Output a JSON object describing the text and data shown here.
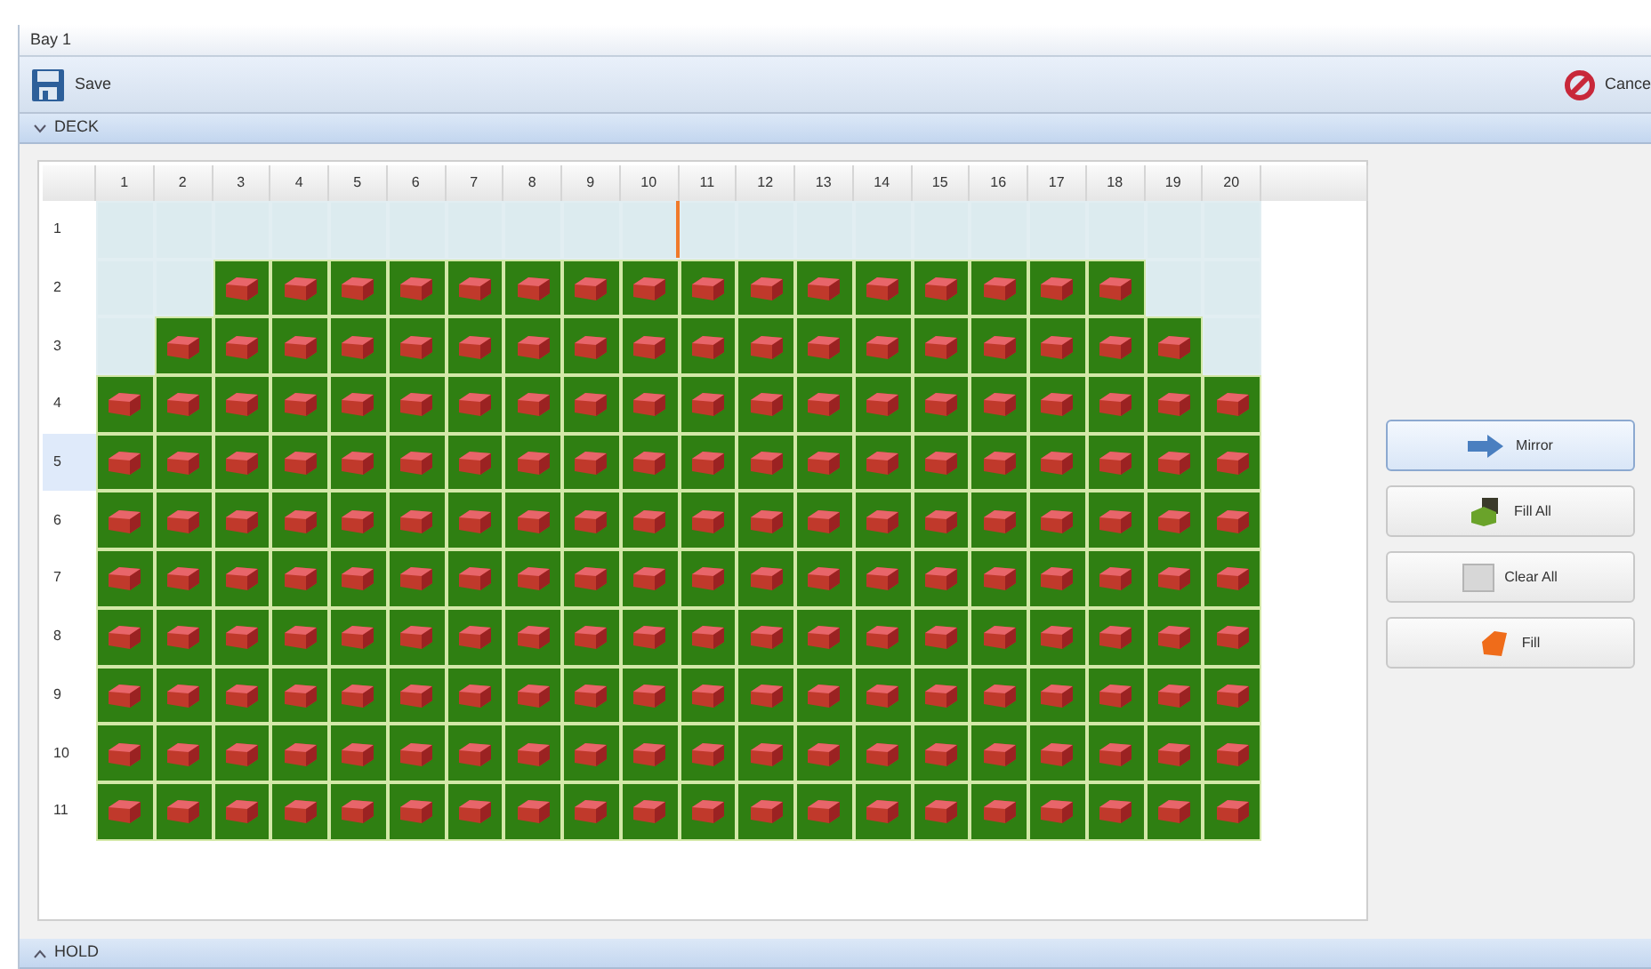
{
  "window": {
    "title": "Bay 1"
  },
  "toolbar": {
    "save": "Save",
    "cancel": "Cance"
  },
  "deck": {
    "title": "DECK",
    "expanded": true,
    "columns": [
      "1",
      "2",
      "3",
      "4",
      "5",
      "6",
      "7",
      "8",
      "9",
      "10",
      "11",
      "12",
      "13",
      "14",
      "15",
      "16",
      "17",
      "18",
      "19",
      "20"
    ],
    "rows": [
      {
        "label": "1",
        "selected": false,
        "filled": [
          false,
          false,
          false,
          false,
          false,
          false,
          false,
          false,
          false,
          false,
          false,
          false,
          false,
          false,
          false,
          false,
          false,
          false,
          false,
          false
        ]
      },
      {
        "label": "2",
        "selected": false,
        "filled": [
          false,
          false,
          true,
          true,
          true,
          true,
          true,
          true,
          true,
          true,
          true,
          true,
          true,
          true,
          true,
          true,
          true,
          true,
          false,
          false
        ]
      },
      {
        "label": "3",
        "selected": false,
        "filled": [
          false,
          true,
          true,
          true,
          true,
          true,
          true,
          true,
          true,
          true,
          true,
          true,
          true,
          true,
          true,
          true,
          true,
          true,
          true,
          false
        ]
      },
      {
        "label": "4",
        "selected": false,
        "filled": [
          true,
          true,
          true,
          true,
          true,
          true,
          true,
          true,
          true,
          true,
          true,
          true,
          true,
          true,
          true,
          true,
          true,
          true,
          true,
          true
        ]
      },
      {
        "label": "5",
        "selected": true,
        "filled": [
          true,
          true,
          true,
          true,
          true,
          true,
          true,
          true,
          true,
          true,
          true,
          true,
          true,
          true,
          true,
          true,
          true,
          true,
          true,
          true
        ]
      },
      {
        "label": "6",
        "selected": false,
        "filled": [
          true,
          true,
          true,
          true,
          true,
          true,
          true,
          true,
          true,
          true,
          true,
          true,
          true,
          true,
          true,
          true,
          true,
          true,
          true,
          true
        ]
      },
      {
        "label": "7",
        "selected": false,
        "filled": [
          true,
          true,
          true,
          true,
          true,
          true,
          true,
          true,
          true,
          true,
          true,
          true,
          true,
          true,
          true,
          true,
          true,
          true,
          true,
          true
        ]
      },
      {
        "label": "8",
        "selected": false,
        "filled": [
          true,
          true,
          true,
          true,
          true,
          true,
          true,
          true,
          true,
          true,
          true,
          true,
          true,
          true,
          true,
          true,
          true,
          true,
          true,
          true
        ]
      },
      {
        "label": "9",
        "selected": false,
        "filled": [
          true,
          true,
          true,
          true,
          true,
          true,
          true,
          true,
          true,
          true,
          true,
          true,
          true,
          true,
          true,
          true,
          true,
          true,
          true,
          true
        ]
      },
      {
        "label": "10",
        "selected": false,
        "filled": [
          true,
          true,
          true,
          true,
          true,
          true,
          true,
          true,
          true,
          true,
          true,
          true,
          true,
          true,
          true,
          true,
          true,
          true,
          true,
          true
        ]
      },
      {
        "label": "11",
        "selected": false,
        "filled": [
          true,
          true,
          true,
          true,
          true,
          true,
          true,
          true,
          true,
          true,
          true,
          true,
          true,
          true,
          true,
          true,
          true,
          true,
          true,
          true
        ]
      }
    ],
    "actions": [
      {
        "label": "Mirror",
        "kind": "mirror",
        "selected": true
      },
      {
        "label": "Fill All",
        "kind": "fill-all",
        "selected": false
      },
      {
        "label": "Clear All",
        "kind": "clear-all",
        "selected": false
      },
      {
        "label": "Fill",
        "kind": "fill",
        "selected": false
      }
    ]
  },
  "hold": {
    "title": "HOLD",
    "expanded": false
  }
}
